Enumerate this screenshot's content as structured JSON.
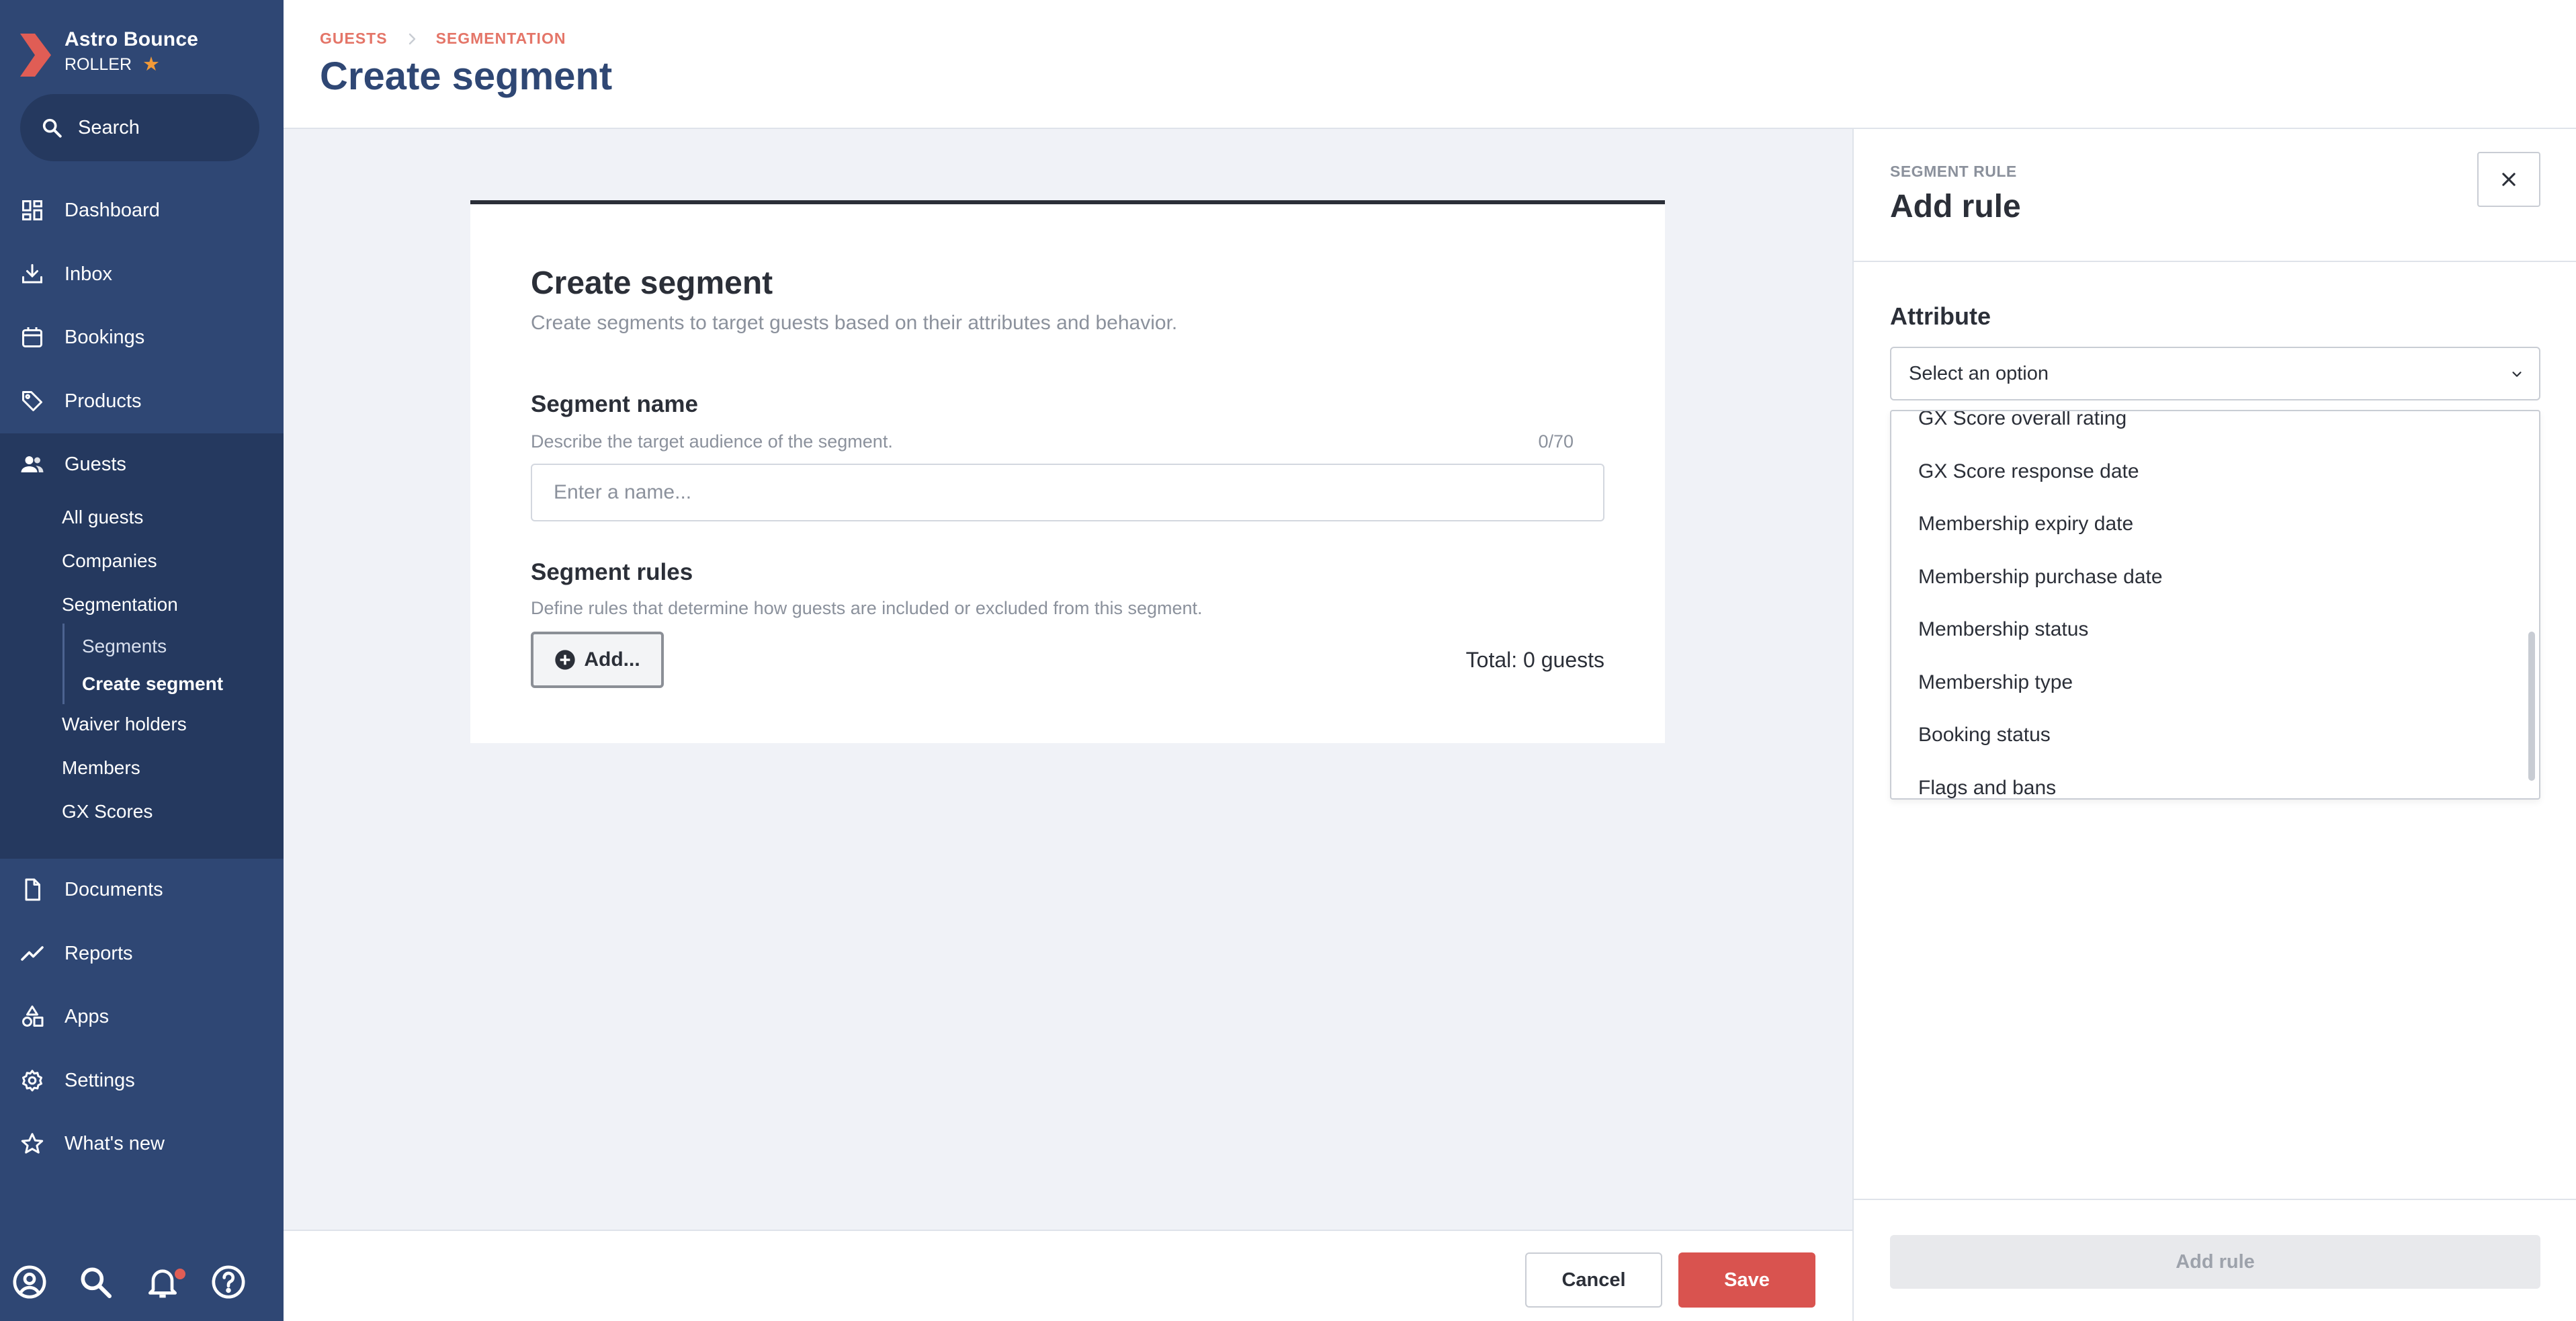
{
  "sidebar": {
    "brand_name": "Astro Bounce",
    "brand_sub": "ROLLER",
    "search_label": "Search",
    "nav": {
      "dashboard": "Dashboard",
      "inbox": "Inbox",
      "bookings": "Bookings",
      "products": "Products",
      "guests": "Guests",
      "documents": "Documents",
      "reports": "Reports",
      "apps": "Apps",
      "settings": "Settings",
      "whats_new": "What's new"
    },
    "guests_sub": {
      "all_guests": "All guests",
      "companies": "Companies",
      "segmentation": "Segmentation",
      "segments": "Segments",
      "create_segment": "Create segment",
      "waiver_holders": "Waiver holders",
      "members": "Members",
      "gx_scores": "GX Scores"
    }
  },
  "header": {
    "breadcrumb": [
      "GUESTS",
      "SEGMENTATION"
    ],
    "title": "Create segment"
  },
  "card": {
    "title": "Create segment",
    "description": "Create segments to target guests based on their attributes and behavior.",
    "segment_name_label": "Segment name",
    "segment_name_hint": "Describe the target audience of the segment.",
    "segment_name_counter": "0/70",
    "segment_name_placeholder": "Enter a name...",
    "segment_name_value": "",
    "rules_label": "Segment rules",
    "rules_hint": "Define rules that determine how guests are included or excluded from this segment.",
    "add_button": "Add...",
    "total": "Total: 0 guests"
  },
  "footer": {
    "cancel": "Cancel",
    "save": "Save"
  },
  "panel": {
    "kicker": "SEGMENT RULE",
    "title": "Add rule",
    "attribute_label": "Attribute",
    "select_placeholder": "Select an option",
    "options": [
      "GX Score overall rating",
      "GX Score response date",
      "Membership expiry date",
      "Membership purchase date",
      "Membership status",
      "Membership type",
      "Booking status",
      "Flags and bans"
    ],
    "add_rule_button": "Add rule"
  },
  "colors": {
    "sidebar_bg": "#2f4774",
    "sidebar_active_bg": "#25395f",
    "accent_red": "#d9534f",
    "breadcrumb": "#e47568",
    "title_navy": "#2f4774",
    "star": "#f29a38"
  }
}
